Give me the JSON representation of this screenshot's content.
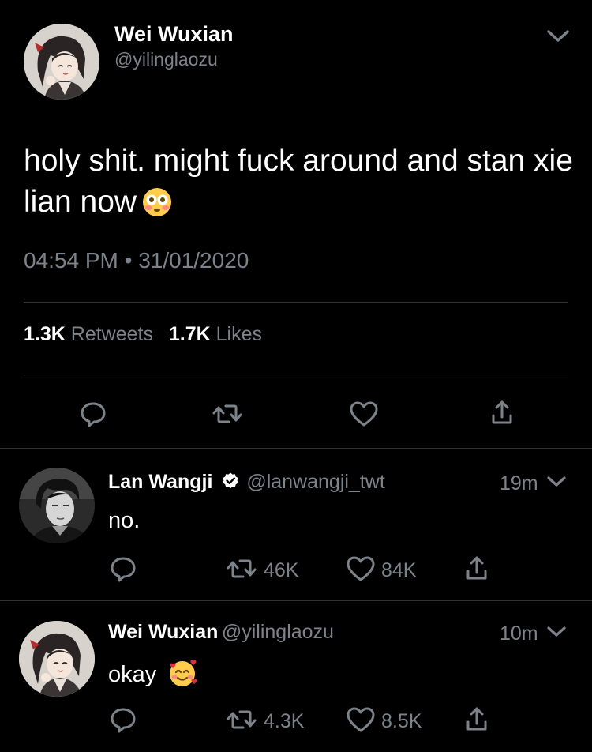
{
  "main_tweet": {
    "display_name": "Wei Wuxian",
    "handle": "@yilinglaozu",
    "text": "holy shit. might fuck around and stan xie lian now",
    "emoji": "flushed-face",
    "timestamp": "04:54 PM • 31/01/2020",
    "retweets_count": "1.3K",
    "retweets_label": "Retweets",
    "likes_count": "1.7K",
    "likes_label": "Likes"
  },
  "replies": [
    {
      "display_name": "Lan Wangji",
      "verified": true,
      "handle": "@lanwangji_twt",
      "time": "19m",
      "text": "no.",
      "retweets": "46K",
      "likes": "84K"
    },
    {
      "display_name": "Wei Wuxian",
      "verified": false,
      "handle": "@yilinglaozu",
      "time": "10m",
      "text": "okay",
      "emoji": "smiling-face-with-hearts",
      "retweets": "4.3K",
      "likes": "8.5K"
    }
  ],
  "colors": {
    "background": "#000000",
    "text": "#ffffff",
    "muted": "#7d838a",
    "divider": "#2f3336"
  }
}
